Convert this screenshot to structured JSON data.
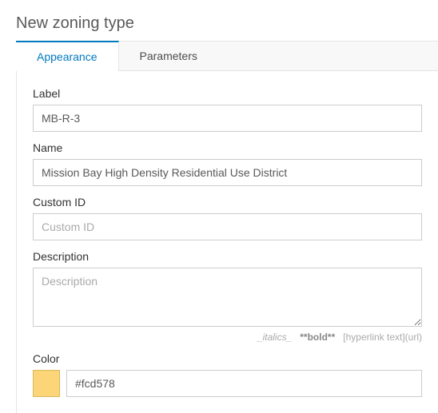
{
  "panel": {
    "title": "New zoning type"
  },
  "tabs": {
    "appearance": "Appearance",
    "parameters": "Parameters"
  },
  "fields": {
    "label": {
      "label": "Label",
      "value": "MB-R-3"
    },
    "name": {
      "label": "Name",
      "value": "Mission Bay High Density Residential Use District"
    },
    "customId": {
      "label": "Custom ID",
      "placeholder": "Custom ID",
      "value": ""
    },
    "description": {
      "label": "Description",
      "placeholder": "Description",
      "value": ""
    },
    "color": {
      "label": "Color",
      "value": "#fcd578"
    }
  },
  "formatHints": {
    "italics": "_italics_",
    "bold": "**bold**",
    "link": "[hyperlink text](url)"
  }
}
